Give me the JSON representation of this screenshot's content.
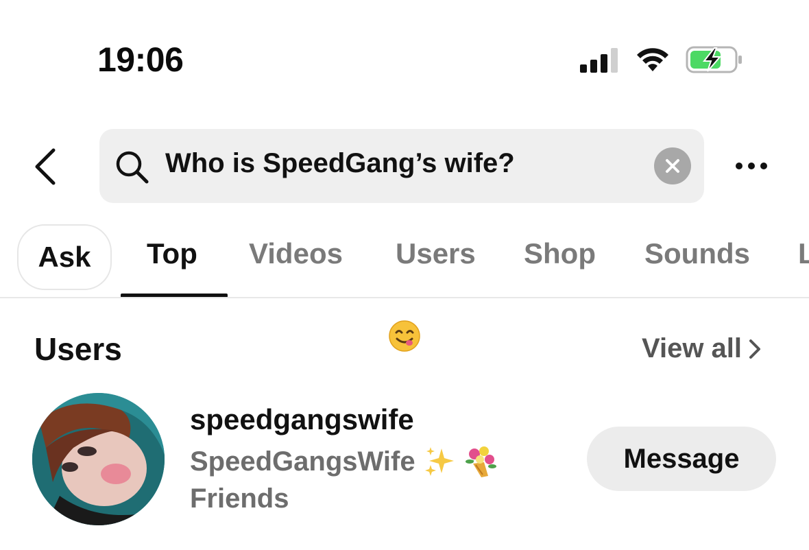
{
  "status_bar": {
    "time": "19:06",
    "icons": [
      "cellular-signal-icon",
      "wifi-icon",
      "battery-charging-icon"
    ],
    "battery_color": "#4cd964"
  },
  "search": {
    "query": "Who is SpeedGang’s wife?",
    "icons": [
      "back-chevron-icon",
      "search-icon",
      "clear-icon",
      "more-icon"
    ]
  },
  "tabs": {
    "items": [
      {
        "label": "Ask"
      },
      {
        "label": "Top"
      },
      {
        "label": "Videos"
      },
      {
        "label": "Users"
      },
      {
        "label": "Shop"
      },
      {
        "label": "Sounds"
      },
      {
        "label": "L"
      }
    ],
    "active": "Top"
  },
  "users_section": {
    "title": "Users",
    "view_all": "View all",
    "user": {
      "username": "speedgangswife",
      "display_name": "SpeedGangsWife",
      "relation": "Friends",
      "message_label": "Message"
    }
  },
  "colors": {
    "search_bg": "#efefef",
    "inactive_tab": "#7a7a7a",
    "secondary_text": "#6d6d6d",
    "button_bg": "#ececec"
  }
}
